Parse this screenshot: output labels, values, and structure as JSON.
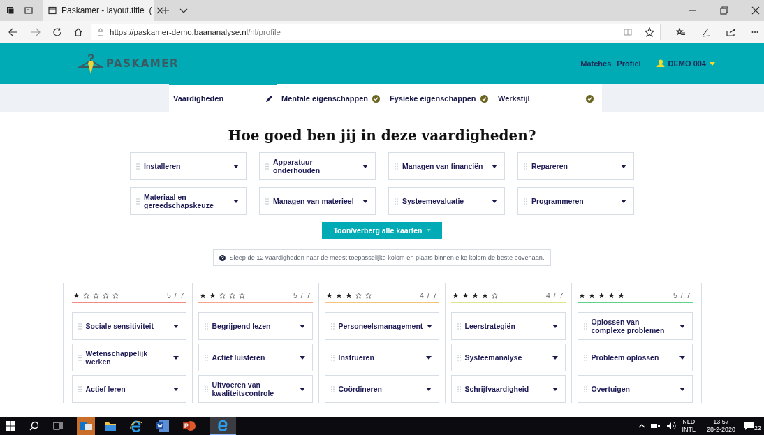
{
  "browser": {
    "tab_title": "Paskamer - layout.title_(",
    "url_host": "https://paskamer-demo.baananalyse.nl",
    "url_path": "/nl/profile"
  },
  "header": {
    "logo": "PASKAMER",
    "nav": [
      "Matches",
      "Profiel"
    ],
    "user": "DEMO 004"
  },
  "steps": [
    {
      "label": "Vaardigheden",
      "kind": "edit",
      "selected": true
    },
    {
      "label": "Mentale eigenschappen",
      "kind": "done",
      "selected": false
    },
    {
      "label": "Fysieke eigenschappen",
      "kind": "done",
      "selected": false
    },
    {
      "label": "Werkstijl",
      "kind": "done",
      "selected": false
    }
  ],
  "title": "Hoe goed ben jij in deze vaardigheden?",
  "pool": [
    "Installeren",
    "Apparatuur onderhouden",
    "Managen van financiën",
    "Repareren",
    "Materiaal en gereedschapskeuze",
    "Managen van materieel",
    "Systeemevaluatie",
    "Programmeren"
  ],
  "toggle_button": "Toon/verberg alle kaarten",
  "hint": "Sleep de 12 vaardigheden naar de meest toepasselijke kolom en plaats binnen elke kolom de beste bovenaan.",
  "columns": [
    {
      "stars": 1,
      "count": "5 / 7",
      "color": "#f28b82",
      "cards": [
        "Sociale sensitiviteit",
        "Wetenschappelijk werken",
        "Actief leren"
      ]
    },
    {
      "stars": 2,
      "count": "5 / 7",
      "color": "#f6a48a",
      "cards": [
        "Begrijpend lezen",
        "Actief luisteren",
        "Uitvoeren van kwaliteitscontrole"
      ]
    },
    {
      "stars": 3,
      "count": "4 / 7",
      "color": "#f5c27a",
      "cards": [
        "Personeelsmanagement",
        "Instrueren",
        "Coördineren"
      ]
    },
    {
      "stars": 4,
      "count": "4 / 7",
      "color": "#dfe38c",
      "cards": [
        "Leerstrategiën",
        "Systeemanalyse",
        "Schrijfvaardigheid"
      ]
    },
    {
      "stars": 5,
      "count": "5 / 7",
      "color": "#5fd38a",
      "cards": [
        "Oplossen van complexe problemen",
        "Probleem oplossen",
        "Overtuigen"
      ]
    }
  ],
  "taskbar": {
    "lang": "NLD",
    "layout": "INTL",
    "time": "13:57",
    "date": "28-2-2020",
    "notifications": "22"
  }
}
